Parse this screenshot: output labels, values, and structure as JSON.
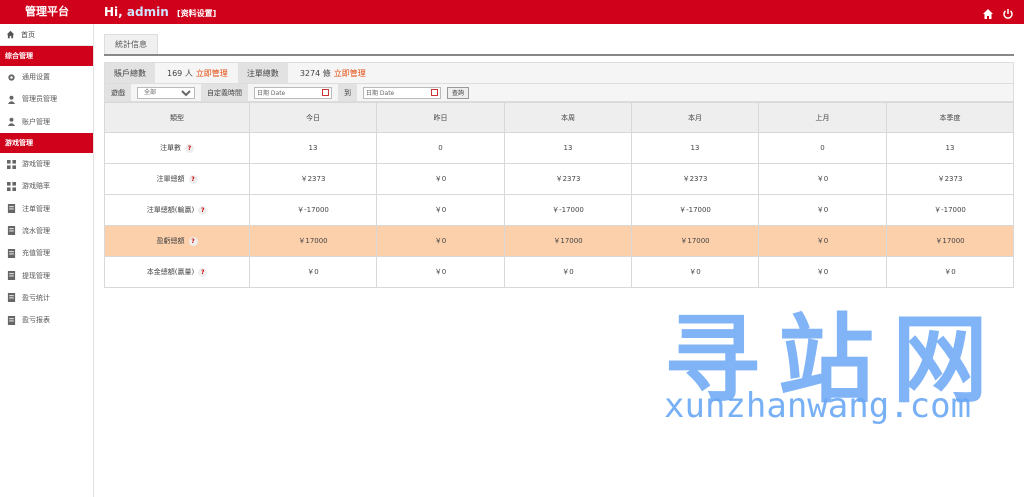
{
  "header": {
    "brand": "管理平台",
    "greeting": "Hi,",
    "username": "admin",
    "profile_link": "[资料设置]",
    "icons": [
      "home-icon",
      "power-icon"
    ]
  },
  "sidebar": {
    "home": "首页",
    "sections": [
      {
        "title": "综合管理",
        "items": [
          {
            "label": "通用设置",
            "icon": "gear-icon"
          },
          {
            "label": "管理员管理",
            "icon": "user-icon"
          },
          {
            "label": "账户管理",
            "icon": "user-icon"
          }
        ]
      },
      {
        "title": "游戏管理",
        "items": [
          {
            "label": "游戏管理",
            "icon": "grid-icon"
          },
          {
            "label": "游戏赔率",
            "icon": "grid-icon"
          },
          {
            "label": "注单管理",
            "icon": "doc-icon"
          },
          {
            "label": "流水管理",
            "icon": "doc-icon"
          },
          {
            "label": "充值管理",
            "icon": "doc-icon"
          },
          {
            "label": "提现管理",
            "icon": "doc-icon"
          },
          {
            "label": "盈亏统计",
            "icon": "doc-icon"
          },
          {
            "label": "盈亏报表",
            "icon": "doc-icon"
          }
        ]
      }
    ]
  },
  "main": {
    "tab": "統計信息",
    "summary": {
      "accounts_label": "賬戶總數",
      "accounts_value": "169 人",
      "accounts_link": "立即管理",
      "bets_label": "注單總數",
      "bets_value": "3274 條",
      "bets_link": "立即管理"
    },
    "filter": {
      "game_label": "遊戲",
      "game_selected": "全部",
      "custom_time_label": "自定義時間",
      "date_placeholder_from": "日期 Date",
      "to_label": "到",
      "date_placeholder_to": "日期 Date",
      "query_button": "查詢"
    },
    "table": {
      "columns": [
        "類型",
        "今日",
        "昨日",
        "本周",
        "本月",
        "上月",
        "本季度"
      ],
      "rows": [
        {
          "label": "注單數",
          "help": true,
          "values": [
            "13",
            "0",
            "13",
            "13",
            "0",
            "13"
          ]
        },
        {
          "label": "注單總額",
          "help": true,
          "values": [
            "￥2373",
            "￥0",
            "￥2373",
            "￥2373",
            "￥0",
            "￥2373"
          ]
        },
        {
          "label": "注單總額(輸贏)",
          "help": true,
          "values": [
            "￥-17000",
            "￥0",
            "￥-17000",
            "￥-17000",
            "￥0",
            "￥-17000"
          ]
        },
        {
          "label": "盈虧總額",
          "help": true,
          "highlight": true,
          "values": [
            "￥17000",
            "￥0",
            "￥17000",
            "￥17000",
            "￥0",
            "￥17000"
          ]
        },
        {
          "label": "本金總額(贏量)",
          "help": true,
          "values": [
            "￥0",
            "￥0",
            "￥0",
            "￥0",
            "￥0",
            "￥0"
          ]
        }
      ]
    }
  },
  "watermark": {
    "cn": "寻站网",
    "en": "xunzhanwang.com"
  },
  "colors": {
    "primary": "#d0021b",
    "link": "#e34a0c",
    "highlight_row": "#fdd0ac",
    "watermark": "#6aa8f5"
  }
}
